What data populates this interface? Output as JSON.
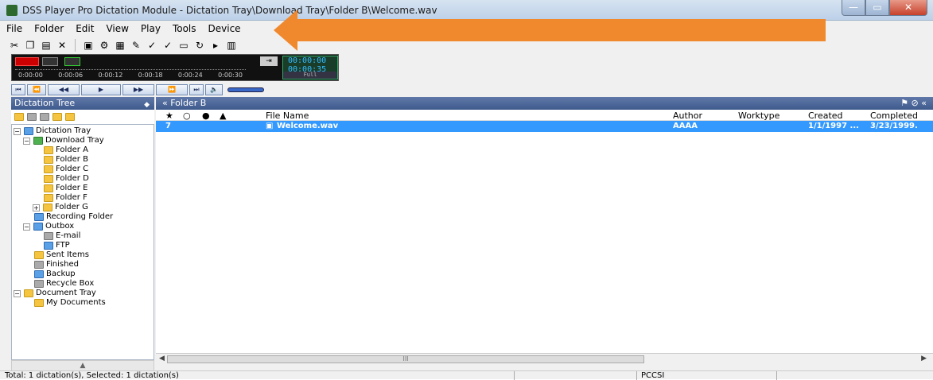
{
  "window": {
    "title": "DSS Player Pro Dictation Module - Dictation Tray\\Download Tray\\Folder B\\Welcome.wav",
    "min_glyph": "—",
    "max_glyph": "▭",
    "close_glyph": "✕"
  },
  "menu": [
    "File",
    "Folder",
    "Edit",
    "View",
    "Play",
    "Tools",
    "Device"
  ],
  "player": {
    "time_current": "00:00:00",
    "time_total": "00:00:35",
    "mode": "Full",
    "timeline_ticks": [
      "0:00:00",
      "0:00:06",
      "0:00:12",
      "0:00:18",
      "0:00:24",
      "0:00:30"
    ]
  },
  "left_panel": {
    "title": "Dictation Tree",
    "tree": {
      "dictation_tray": "Dictation Tray",
      "download_tray": "Download Tray",
      "folder_a": "Folder A",
      "folder_b": "Folder B",
      "folder_c": "Folder C",
      "folder_d": "Folder D",
      "folder_e": "Folder E",
      "folder_f": "Folder F",
      "folder_g": "Folder G",
      "recording_folder": "Recording Folder",
      "outbox": "Outbox",
      "email": "E-mail",
      "ftp": "FTP",
      "sent_items": "Sent Items",
      "finished": "Finished",
      "backup": "Backup",
      "recycle_box": "Recycle Box",
      "document_tray": "Document Tray",
      "my_documents": "My Documents"
    }
  },
  "right_panel": {
    "title": "« Folder B",
    "columns": {
      "file_name": "File Name",
      "author": "Author",
      "worktype": "Worktype",
      "created": "Created",
      "completed": "Completed"
    },
    "rows": [
      {
        "id": "7",
        "file_name": "Welcome.wav",
        "author": "AAAA",
        "worktype": "",
        "created": "1/1/1997 ...",
        "completed": "3/23/1999."
      }
    ],
    "scroll_thumb": "III"
  },
  "status": {
    "summary": "Total: 1 dictation(s), Selected: 1 dictation(s)",
    "device": "PCCSI"
  },
  "colors": {
    "accent": "#3399ff",
    "arrow": "#f0892e",
    "panel_header": "#4a6799"
  }
}
